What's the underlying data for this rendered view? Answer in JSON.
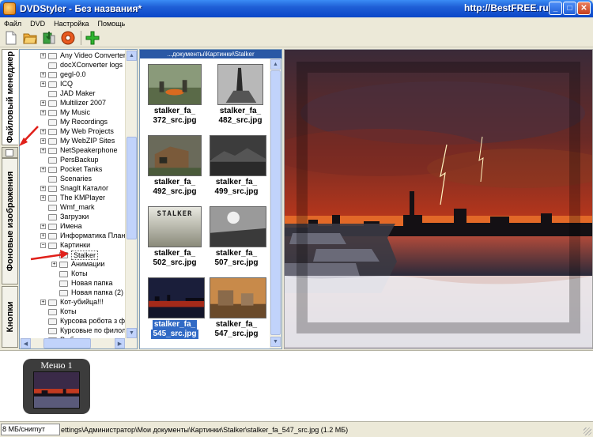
{
  "window": {
    "title": "DVDStyler - Без названия*",
    "watermark": "http://BestFREE.ru"
  },
  "menubar": [
    "Файл",
    "DVD",
    "Настройка",
    "Помощь"
  ],
  "toolbar": {
    "buttons": [
      "new-file-icon",
      "open-folder-icon",
      "save-icon",
      "burn-disc-icon",
      "add-icon"
    ]
  },
  "tabs": {
    "file_manager": "Файловый менеджер",
    "backgrounds": "Фоновые изображения",
    "buttons": "Кнопки"
  },
  "tree": {
    "items": [
      {
        "label": "Any Video Converter",
        "level": 1,
        "expander": "+"
      },
      {
        "label": "docXConverter logs",
        "level": 1,
        "expander": ""
      },
      {
        "label": "gegl-0.0",
        "level": 1,
        "expander": "+"
      },
      {
        "label": "ICQ",
        "level": 1,
        "expander": "+"
      },
      {
        "label": "JAD Maker",
        "level": 1,
        "expander": ""
      },
      {
        "label": "Multilizer 2007",
        "level": 1,
        "expander": "+"
      },
      {
        "label": "My Music",
        "level": 1,
        "expander": "+"
      },
      {
        "label": "My Recordings",
        "level": 1,
        "expander": ""
      },
      {
        "label": "My Web Projects",
        "level": 1,
        "expander": "+"
      },
      {
        "label": "My WebZIP Sites",
        "level": 1,
        "expander": "+"
      },
      {
        "label": "NetSpeakerphone",
        "level": 1,
        "expander": "+"
      },
      {
        "label": "PersBackup",
        "level": 1,
        "expander": ""
      },
      {
        "label": "Pocket Tanks",
        "level": 1,
        "expander": "+"
      },
      {
        "label": "Scenaries",
        "level": 1,
        "expander": ""
      },
      {
        "label": "SnagIt Каталог",
        "level": 1,
        "expander": "+"
      },
      {
        "label": "The KMPlayer",
        "level": 1,
        "expander": "+"
      },
      {
        "label": "Wmf_mark",
        "level": 1,
        "expander": ""
      },
      {
        "label": "Загрузки",
        "level": 1,
        "expander": ""
      },
      {
        "label": "Имена",
        "level": 1,
        "expander": "+"
      },
      {
        "label": "Информатика Планы",
        "level": 1,
        "expander": "+"
      },
      {
        "label": "Картинки",
        "level": 1,
        "expander": "−"
      },
      {
        "label": "Stalker",
        "level": 2,
        "expander": "",
        "selected": true
      },
      {
        "label": "Анимации",
        "level": 2,
        "expander": "+"
      },
      {
        "label": "Коты",
        "level": 2,
        "expander": ""
      },
      {
        "label": "Новая папка",
        "level": 2,
        "expander": ""
      },
      {
        "label": "Новая папка (2)",
        "level": 2,
        "expander": ""
      },
      {
        "label": "Кот-убийца!!!",
        "level": 1,
        "expander": "+"
      },
      {
        "label": "Коты",
        "level": 1,
        "expander": ""
      },
      {
        "label": "Курсова робота з філ",
        "level": 1,
        "expander": ""
      },
      {
        "label": "Курсовые по филолог",
        "level": 1,
        "expander": ""
      },
      {
        "label": "Рыбки",
        "level": 1,
        "expander": ""
      }
    ]
  },
  "thumbs": {
    "path": "...документы\\Картинки\\Stalker",
    "items": [
      {
        "line1": "stalker_fa_",
        "line2": "372_src.jpg"
      },
      {
        "line1": "stalker_fa_",
        "line2": "482_src.jpg"
      },
      {
        "line1": "stalker_fa_",
        "line2": "492_src.jpg"
      },
      {
        "line1": "stalker_fa_",
        "line2": "499_src.jpg"
      },
      {
        "line1": "stalker_fa_",
        "line2": "502_src.jpg"
      },
      {
        "line1": "stalker_fa_",
        "line2": "507_src.jpg"
      },
      {
        "line1": "stalker_fa_",
        "line2": "545_src.jpg",
        "selected": true
      },
      {
        "line1": "stalker_fa_",
        "line2": "547_src.jpg"
      }
    ],
    "stalker_logo_text": "STALKER"
  },
  "menus": {
    "card_title": "Меню 1"
  },
  "status": {
    "field": "8 МБ/сниmут",
    "path": "ettings\\Администратор\\Мои документы\\Картинки\\Stalker\\stalker_fa_547_src.jpg (1.2 МБ)"
  },
  "colors": {
    "titlebar": "#0a46c8",
    "selection": "#316ac5",
    "path_bar": "#2a58a5",
    "annotation_arrow": "#e0201a"
  }
}
